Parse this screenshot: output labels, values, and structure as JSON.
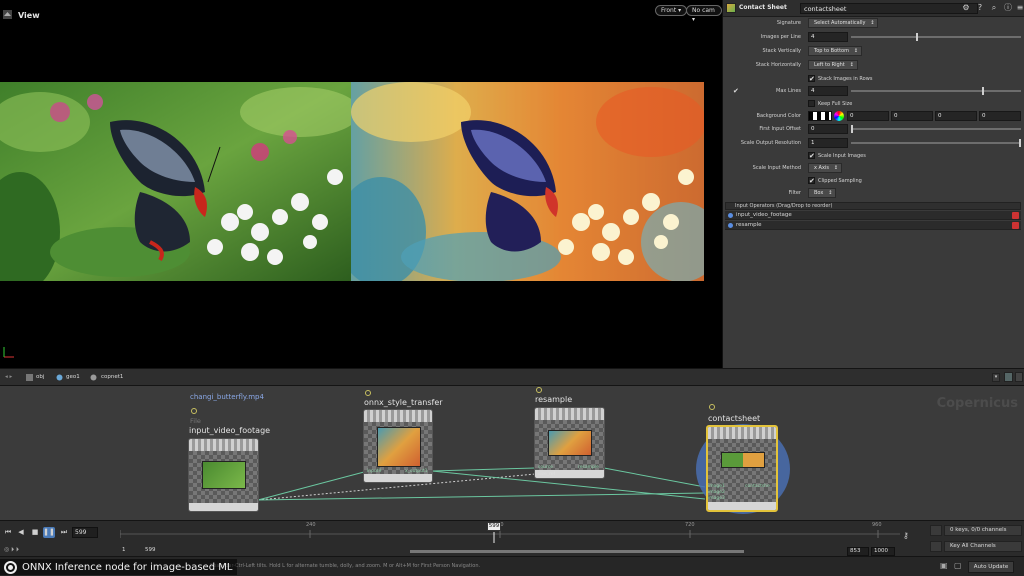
{
  "viewport": {
    "title": "View",
    "front_btn": "Front",
    "cam_btn": "No cam"
  },
  "params": {
    "node_type": "Contact Sheet",
    "node_name": "contactsheet",
    "signature_label": "Signature",
    "signature_value": "Select Automatically",
    "images_per_line_label": "Images per Line",
    "images_per_line_value": "4",
    "images_per_line_fraction": 0.38,
    "stack_vert_label": "Stack Vertically",
    "stack_vert_value": "Top to Bottom",
    "stack_horiz_label": "Stack Horizontally",
    "stack_horiz_value": "Left to Right",
    "stack_rows_label": "Stack Images in Rows",
    "max_lines_label": "Max Lines",
    "max_lines_value": "4",
    "max_lines_fraction": 0.77,
    "keep_full_label": "Keep Full Size",
    "bg_color_label": "Background Color",
    "bg_values": [
      "0",
      "0",
      "0",
      "0"
    ],
    "first_input_label": "First Input Offset",
    "first_input_value": "0",
    "scale_res_label": "Scale Output Resolution",
    "scale_res_value": "1",
    "scale_input_label": "Scale Input Images",
    "scale_method_label": "Scale Input Method",
    "scale_method_value": "x Axis",
    "clipped_label": "Clipped Sampling",
    "filter_label": "Filter",
    "filter_value": "Box",
    "inputs_header": "Input Operators (Drag/Drop to reorder)",
    "inputs": [
      "input_video_footage",
      "resample"
    ]
  },
  "network_bar": {
    "crumbs": [
      "obj",
      "geo1",
      "copnet1"
    ]
  },
  "network": {
    "context_label": "Copernicus",
    "file_name": "changi_butterfly.mp4",
    "file_label": "File",
    "nodes": {
      "input": {
        "title": "input_video_footage"
      },
      "onnx": {
        "title": "onnx_style_transfer",
        "in_port": "input9",
        "out_port": "x_output1"
      },
      "resample": {
        "title": "resample",
        "in_port1": "source",
        "in_port2": "size_ref",
        "out_port": "resample"
      },
      "contact": {
        "title": "contactsheet",
        "in_ports": [
          "image1",
          "image2",
          "image3"
        ],
        "out_port": "contactshe"
      }
    }
  },
  "timeline": {
    "current_frame": "599",
    "ticks": [
      "240",
      "480",
      "720",
      "960"
    ],
    "marker": "599",
    "range_start": "1",
    "range_start2": "599",
    "range_end": "853",
    "range_end2": "1000",
    "keys_label": "0 keys, 0/0 channels",
    "key_all_label": "Key All Channels"
  },
  "status": {
    "hint": "Spacebar-Ctrl-Left tilts. Hold L for alternate tumble, dolly, and zoom. M or Alt+M for First Person Navigation.",
    "caption": "ONNX Inference node for image-based ML",
    "auto_update": "Auto Update"
  }
}
